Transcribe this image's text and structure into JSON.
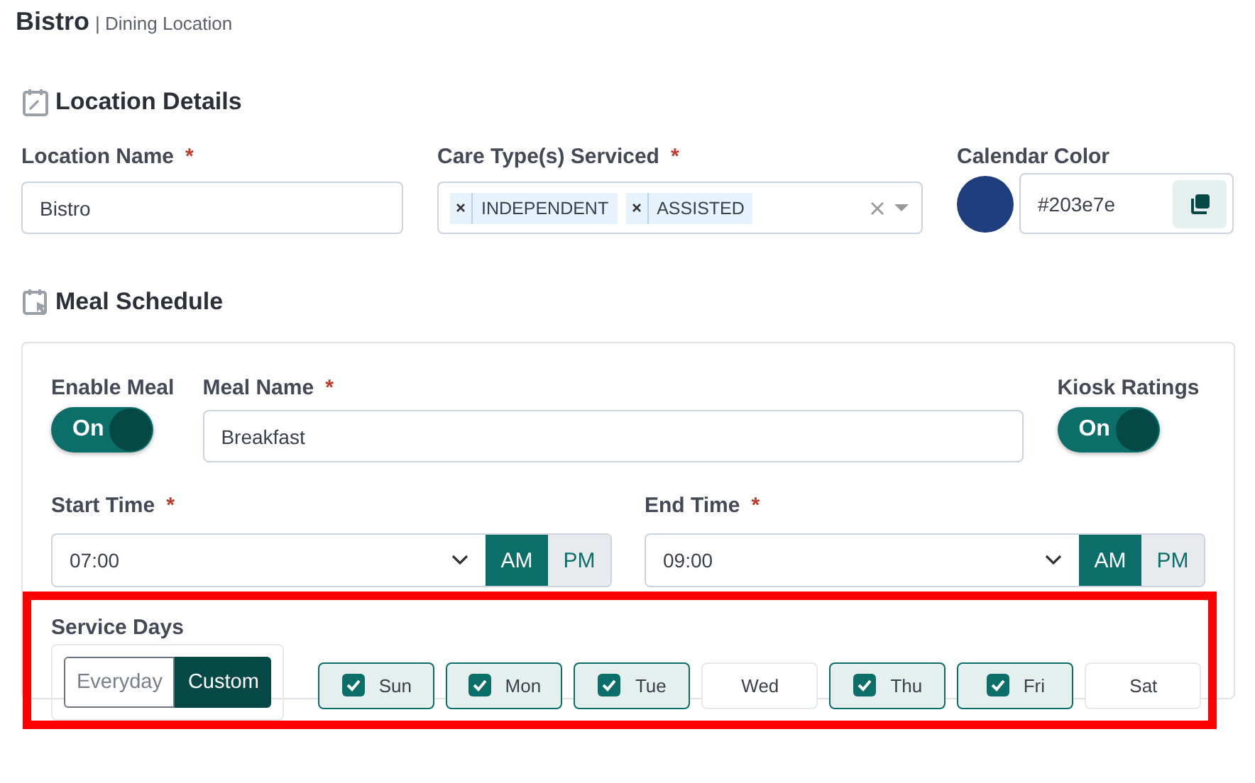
{
  "header": {
    "title": "Bistro",
    "subtitle": "| Dining Location"
  },
  "location_details": {
    "heading": "Location Details",
    "location_name": {
      "label": "Location Name",
      "required_mark": "*",
      "value": "Bistro"
    },
    "care_types": {
      "label": "Care Type(s) Serviced",
      "required_mark": "*",
      "tags": [
        "INDEPENDENT",
        "ASSISTED"
      ]
    },
    "calendar_color": {
      "label": "Calendar Color",
      "color": "#203e7e",
      "value": "#203e7e"
    }
  },
  "meal_schedule": {
    "heading": "Meal Schedule",
    "enable_meal": {
      "label": "Enable Meal",
      "on": true,
      "text": "On"
    },
    "meal_name": {
      "label": "Meal Name",
      "required_mark": "*",
      "value": "Breakfast"
    },
    "kiosk_ratings": {
      "label": "Kiosk Ratings",
      "on": true,
      "text": "On"
    },
    "start_time": {
      "label": "Start Time",
      "required_mark": "*",
      "value": "07:00",
      "periods": [
        {
          "label": "AM",
          "selected": true
        },
        {
          "label": "PM",
          "selected": false
        }
      ]
    },
    "end_time": {
      "label": "End Time",
      "required_mark": "*",
      "value": "09:00",
      "periods": [
        {
          "label": "AM",
          "selected": true
        },
        {
          "label": "PM",
          "selected": false
        }
      ]
    },
    "service_days": {
      "label": "Service Days",
      "highlighted": true,
      "modes": [
        {
          "label": "Everyday",
          "selected": false
        },
        {
          "label": "Custom",
          "selected": true
        }
      ],
      "days": [
        {
          "label": "Sun",
          "checked": true
        },
        {
          "label": "Mon",
          "checked": true
        },
        {
          "label": "Tue",
          "checked": true
        },
        {
          "label": "Wed",
          "checked": false
        },
        {
          "label": "Thu",
          "checked": true
        },
        {
          "label": "Fri",
          "checked": true
        },
        {
          "label": "Sat",
          "checked": false
        }
      ]
    }
  }
}
